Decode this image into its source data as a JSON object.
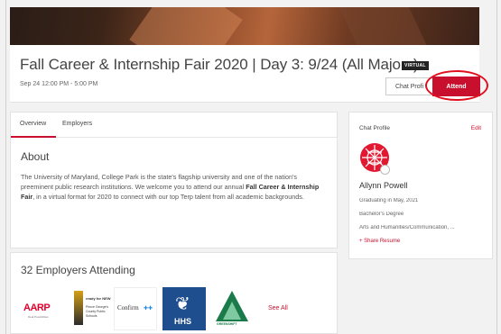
{
  "header": {
    "title": "Fall Career & Internship Fair 2020 | Day 3: 9/24 (All Majors)",
    "badge": "VIRTUAL",
    "date": "Sep 24 12:00 PM - 5:00 PM",
    "chat_button": "Chat Profi",
    "attend_button": "Attend"
  },
  "tabs": [
    {
      "label": "Overview"
    },
    {
      "label": "Employers"
    }
  ],
  "about": {
    "title": "About",
    "text_1": "The University of Maryland, College Park is the state's flagship university and one of the nation's preeminent public research institutions. We welcome you to attend our annual ",
    "text_bold": "Fall Career & Internship Fair",
    "text_2": ", in a virtual format for 2020 to connect with our top Terp talent from all academic backgrounds."
  },
  "employers": {
    "title": "32 Employers Attending",
    "see_all": "See All",
    "logos": {
      "aarp": "AARP",
      "aarp_sub": "Real Possibilities",
      "pgcps_line1": "ready for NEW",
      "pgcps_line2": "Prince George's County Public Schools",
      "confirm": "Confirm",
      "hhs": "HHS",
      "greenshift": "GREENSHIFT"
    }
  },
  "profile": {
    "title": "Chat Profile",
    "edit": "Edit",
    "name": "Allynn Powell",
    "graduation": "Graduating in May, 2021",
    "degree": "Bachelor's Degree",
    "major": "Arts and Humanities/Communication, ...",
    "share": "+ Share Resume"
  },
  "colors": {
    "accent": "#c8102e",
    "annotation": "#e0101f"
  }
}
